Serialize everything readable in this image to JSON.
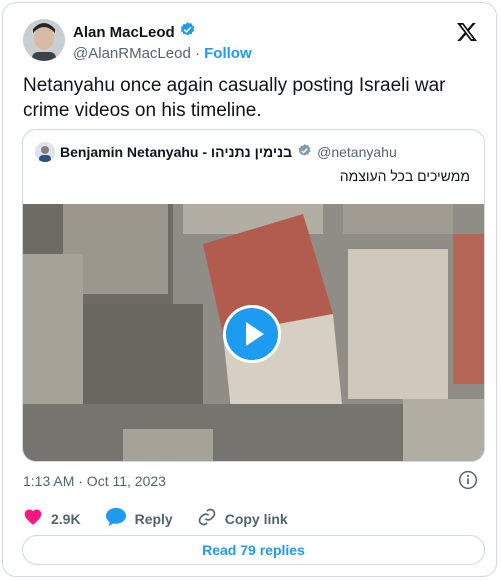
{
  "author": {
    "name": "Alan MacLeod",
    "handle": "@AlanRMacLeod",
    "separator": "·",
    "follow_label": "Follow"
  },
  "tweet": {
    "text": "Netanyahu once again casually posting Israeli war crime videos on his timeline."
  },
  "quoted": {
    "name": "Benjamin Netanyahu - בנימין נתניהו",
    "handle": "@netanyahu",
    "text": "ממשיכים בכל העוצמה"
  },
  "meta": {
    "timestamp": "1:13 AM · Oct 11, 2023"
  },
  "actions": {
    "likes": "2.9K",
    "reply_label": "Reply",
    "copy_label": "Copy link",
    "read_replies": "Read 79 replies"
  },
  "icons": {
    "verified": "verified-badge-icon",
    "x_logo": "x-logo-icon",
    "play": "play-icon",
    "info": "info-icon",
    "heart": "heart-icon",
    "reply": "reply-bubble-icon",
    "link": "link-icon"
  },
  "colors": {
    "accent": "#1d9bf0",
    "like": "#f91880",
    "text": "#0f1419",
    "secondary": "#536471"
  }
}
